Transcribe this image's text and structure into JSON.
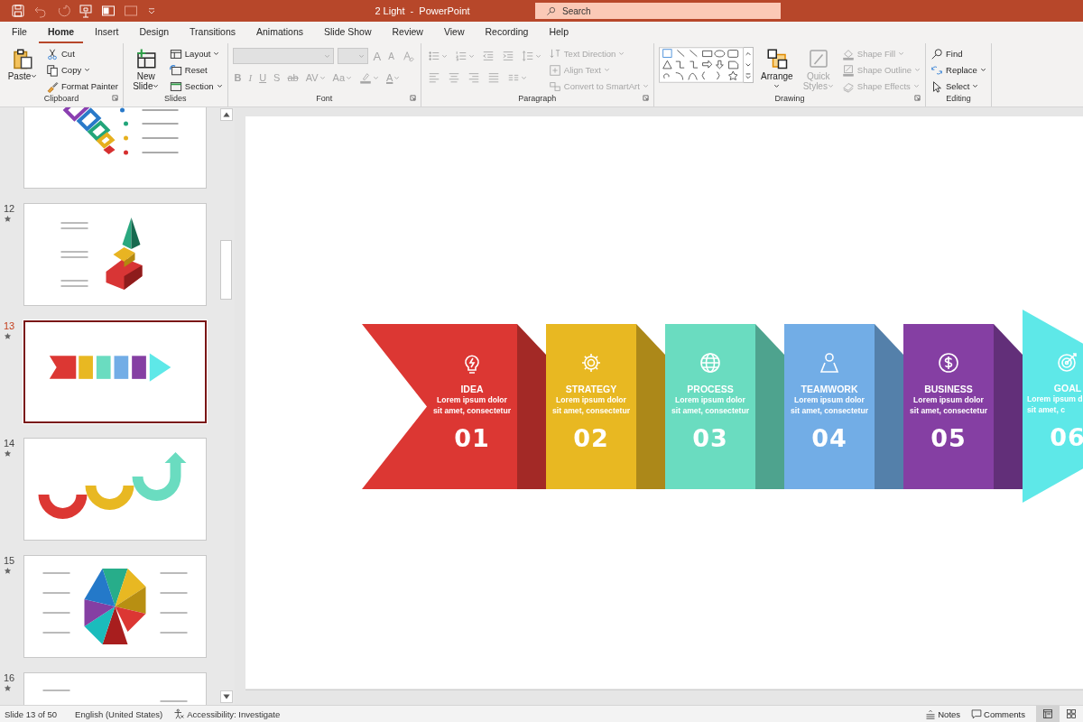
{
  "window": {
    "title": "2 Light  -  PowerPoint"
  },
  "search": {
    "placeholder": "Search"
  },
  "tabs": [
    {
      "label": "File",
      "selected": false
    },
    {
      "label": "Home",
      "selected": true
    },
    {
      "label": "Insert",
      "selected": false
    },
    {
      "label": "Design",
      "selected": false
    },
    {
      "label": "Transitions",
      "selected": false
    },
    {
      "label": "Animations",
      "selected": false
    },
    {
      "label": "Slide Show",
      "selected": false
    },
    {
      "label": "Review",
      "selected": false
    },
    {
      "label": "View",
      "selected": false
    },
    {
      "label": "Recording",
      "selected": false
    },
    {
      "label": "Help",
      "selected": false
    }
  ],
  "ribbon": {
    "groups": [
      {
        "label": "Clipboard",
        "launcher": true,
        "blocks": [
          {
            "kind": "large",
            "item": {
              "kind": "clipboard",
              "label": "Paste",
              "dropdown": true,
              "disabled": false
            }
          },
          {
            "kind": "stack",
            "items": [
              {
                "kind": "scissors",
                "label": "Cut",
                "dropdown": false,
                "disabled": false
              },
              {
                "kind": "copy",
                "label": "Copy",
                "dropdown": true,
                "disabled": false
              },
              {
                "kind": "paintbrush",
                "label": "Format Painter",
                "dropdown": false,
                "disabled": false
              }
            ]
          }
        ]
      },
      {
        "label": "Slides",
        "launcher": false,
        "blocks": [
          {
            "kind": "large",
            "item": {
              "kind": "new-slide",
              "label": "New\nSlide",
              "dropdown": true,
              "disabled": false
            }
          },
          {
            "kind": "stack",
            "items": [
              {
                "kind": "layout",
                "label": "Layout",
                "dropdown": true,
                "disabled": false
              },
              {
                "kind": "reset",
                "label": "Reset",
                "dropdown": false,
                "disabled": false
              },
              {
                "kind": "section",
                "label": "Section",
                "dropdown": true,
                "disabled": false
              }
            ]
          }
        ]
      },
      {
        "label": "Font",
        "launcher": true,
        "blocks": [
          {
            "kind": "rows",
            "rows": [
              {
                "items": [
                  {
                    "kind": "font-name-combo",
                    "dropdown": true,
                    "disabled": true
                  },
                  {
                    "kind": "font-size-combo",
                    "dropdown": true,
                    "disabled": true
                  },
                  {
                    "kind": "grow-font",
                    "text": "A",
                    "dropdown": false,
                    "disabled": true
                  },
                  {
                    "kind": "shrink-font",
                    "text": "A",
                    "dropdown": false,
                    "disabled": true
                  },
                  {
                    "kind": "clear-format",
                    "dropdown": false,
                    "disabled": true
                  }
                ]
              },
              {
                "items": [
                  {
                    "kind": "bold",
                    "text": "B",
                    "dropdown": false,
                    "disabled": true
                  },
                  {
                    "kind": "italic",
                    "text": "I",
                    "dropdown": false,
                    "disabled": true
                  },
                  {
                    "kind": "underline",
                    "text": "U",
                    "dropdown": false,
                    "disabled": true
                  },
                  {
                    "kind": "shadow",
                    "text": "S",
                    "dropdown": false,
                    "disabled": true
                  },
                  {
                    "kind": "strikethrough",
                    "text": "ab",
                    "dropdown": false,
                    "disabled": true
                  },
                  {
                    "kind": "spacing",
                    "text": "AV",
                    "dropdown": true,
                    "disabled": true
                  },
                  {
                    "kind": "change-case",
                    "text": "Aa",
                    "dropdown": true,
                    "disabled": true
                  },
                  {
                    "kind": "highlighter",
                    "dropdown": true,
                    "disabled": true
                  },
                  {
                    "kind": "font-color",
                    "text": "A",
                    "dropdown": true,
                    "disabled": true
                  }
                ]
              }
            ]
          }
        ]
      },
      {
        "label": "Paragraph",
        "launcher": true,
        "blocks": [
          {
            "kind": "rows",
            "rows": [
              {
                "items": [
                  {
                    "kind": "bullets",
                    "dropdown": true,
                    "disabled": true
                  },
                  {
                    "kind": "numbering",
                    "dropdown": true,
                    "disabled": true
                  },
                  {
                    "kind": "outdent",
                    "dropdown": false,
                    "disabled": true
                  },
                  {
                    "kind": "indent",
                    "dropdown": false,
                    "disabled": true
                  },
                  {
                    "kind": "line-spacing",
                    "dropdown": true,
                    "disabled": true
                  }
                ]
              },
              {
                "items": [
                  {
                    "kind": "align-left",
                    "dropdown": false,
                    "disabled": true
                  },
                  {
                    "kind": "align-center",
                    "dropdown": false,
                    "disabled": true
                  },
                  {
                    "kind": "align-right",
                    "dropdown": false,
                    "disabled": true
                  },
                  {
                    "kind": "justify",
                    "dropdown": false,
                    "disabled": true
                  },
                  {
                    "kind": "columns",
                    "dropdown": true,
                    "disabled": true
                  }
                ]
              }
            ]
          },
          {
            "kind": "stack",
            "items": [
              {
                "kind": "text-direction",
                "label": "Text Direction",
                "dropdown": true,
                "disabled": true
              },
              {
                "kind": "align-text",
                "label": "Align Text",
                "dropdown": true,
                "disabled": true
              },
              {
                "kind": "smartart",
                "label": "Convert to SmartArt",
                "dropdown": true,
                "disabled": true
              }
            ]
          }
        ]
      },
      {
        "label": "Drawing",
        "launcher": true,
        "blocks": [
          {
            "kind": "gallery"
          },
          {
            "kind": "large",
            "item": {
              "kind": "arrange",
              "label": "Arrange",
              "dropdown": true,
              "disabled": false
            }
          },
          {
            "kind": "large",
            "item": {
              "kind": "quick-styles",
              "label": "Quick\nStyles",
              "dropdown": true,
              "disabled": true
            }
          },
          {
            "kind": "stack",
            "items": [
              {
                "kind": "shape-fill",
                "label": "Shape Fill",
                "dropdown": true,
                "disabled": true
              },
              {
                "kind": "shape-outline",
                "label": "Shape Outline",
                "dropdown": true,
                "disabled": true
              },
              {
                "kind": "shape-effects",
                "label": "Shape Effects",
                "dropdown": true,
                "disabled": true
              }
            ]
          }
        ]
      },
      {
        "label": "Editing",
        "launcher": false,
        "blocks": [
          {
            "kind": "stack",
            "items": [
              {
                "kind": "search",
                "label": "Find",
                "dropdown": false,
                "disabled": false
              },
              {
                "kind": "replace",
                "label": "Replace",
                "dropdown": true,
                "disabled": false
              },
              {
                "kind": "cursor",
                "label": "Select",
                "dropdown": true,
                "disabled": false
              }
            ]
          }
        ]
      }
    ]
  },
  "thumbnails": [
    {
      "kind": "diamonds",
      "selected": false
    },
    {
      "number": "12",
      "kind": "pyramid",
      "selected": false
    },
    {
      "number": "13",
      "kind": "arrows",
      "selected": true
    },
    {
      "number": "14",
      "kind": "waves",
      "selected": false
    },
    {
      "number": "15",
      "kind": "octagon",
      "selected": false
    },
    {
      "number": "16",
      "kind": "halfwheel",
      "selected": false
    }
  ],
  "slide": {
    "steps": [
      {
        "kind": "chevron",
        "title": "IDEA",
        "body": "Lorem ipsum dolor\nsit amet, consectetur",
        "number": "01",
        "color": "#dc3733"
      },
      {
        "kind": "panel",
        "title": "STRATEGY",
        "body": "Lorem ipsum dolor\nsit amet, consectetur",
        "number": "02",
        "color": "#e8b822"
      },
      {
        "kind": "panel",
        "title": "PROCESS",
        "body": "Lorem ipsum dolor\nsit amet, consectetur",
        "number": "03",
        "color": "#6adcc0"
      },
      {
        "kind": "panel",
        "title": "TEAMWORK",
        "body": "Lorem ipsum dolor\nsit amet, consectetur",
        "number": "04",
        "color": "#72ade6"
      },
      {
        "kind": "panel",
        "title": "BUSINESS",
        "body": "Lorem ipsum dolor\nsit amet, consectetur",
        "number": "05",
        "color": "#853fa3"
      },
      {
        "kind": "arrow",
        "title": "GOAL",
        "body": "Lorem ipsum d\nsit amet, c",
        "number": "06",
        "color": "#5ee8e8"
      }
    ]
  },
  "status_bar": {
    "slide": "Slide 13 of 50",
    "language": "English (United States)",
    "accessibility": "Accessibility: Investigate",
    "notes": "Notes",
    "comments": "Comments"
  }
}
